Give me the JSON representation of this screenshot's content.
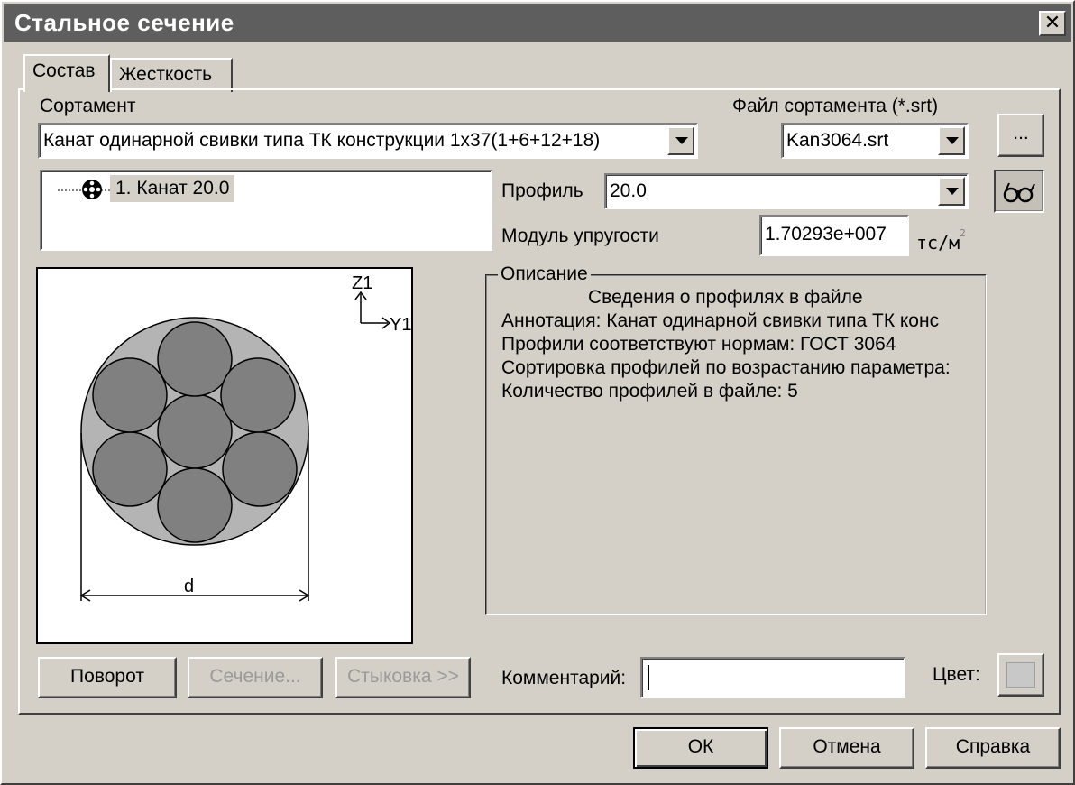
{
  "window": {
    "title": "Стальное сечение",
    "close_glyph": "✕"
  },
  "tabs": [
    {
      "label": "Состав",
      "active": true
    },
    {
      "label": "Жесткость",
      "active": false
    }
  ],
  "sortament": {
    "label": "Сортамент",
    "value": "Канат одинарной свивки типа ТК конструкции 1x37(1+6+12+18)"
  },
  "sortament_file": {
    "label": "Файл сортамента (*.srt)",
    "value": "Kan3064.srt",
    "browse_label": "..."
  },
  "tree": {
    "items": [
      {
        "label": "1. Канат 20.0",
        "icon": "cable-section-icon"
      }
    ]
  },
  "profile": {
    "label": "Профиль",
    "value": "20.0"
  },
  "modulus": {
    "label": "Модуль упругости",
    "value": "1.70293e+007",
    "unit": "тс/м",
    "unit_exp": "2"
  },
  "preview": {
    "axis_z": "Z1",
    "axis_y": "Y1",
    "dim_label": "d"
  },
  "description": {
    "title": "Описание",
    "heading": "Сведения о профилях в файле",
    "lines": [
      "Аннотация: Канат одинарной свивки типа ТК конс",
      "Профили соответствуют нормам: ГОСТ 3064",
      "Сортировка профилей по возрастанию параметра:",
      "Количество профилей в файле: 5"
    ]
  },
  "actions": {
    "rotate": "Поворот",
    "section": "Сечение...",
    "joint": "Стыковка >>"
  },
  "comment": {
    "label": "Комментарий:",
    "value": ""
  },
  "color": {
    "label": "Цвет:",
    "swatch": "#c8c8c8"
  },
  "footer": {
    "ok": "ОК",
    "cancel": "Отмена",
    "help": "Справка"
  },
  "colors": {
    "titlebar": "#5e5e5e",
    "face": "#d4d0c8",
    "section_fill": "#b4b4b4",
    "wire_fill": "#808080"
  }
}
